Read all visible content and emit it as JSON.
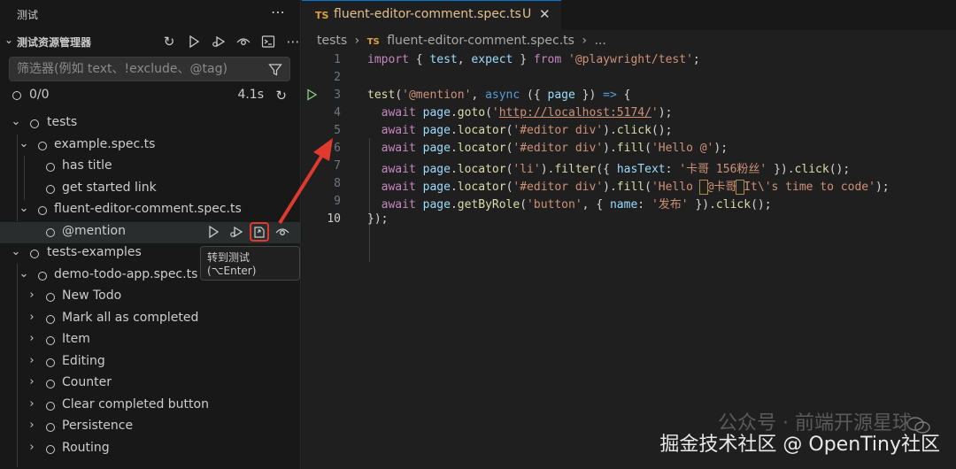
{
  "sidebar": {
    "title": "测试",
    "explorer_title": "测试资源管理器",
    "filter_placeholder": "筛选器(例如 text、!exclude、@tag)",
    "status_count": "0/0",
    "status_time": "4.1s",
    "toolbar_icons": [
      "refresh-icon",
      "run-all-icon",
      "debug-all-icon",
      "watch-icon",
      "terminal-icon",
      "more-icon"
    ]
  },
  "tree": {
    "tests": "tests",
    "example_spec": "example.spec.ts",
    "has_title": "has title",
    "get_started": "get started link",
    "fluent_spec": "fluent-editor-comment.spec.ts",
    "mention": "@mention",
    "tests_examples": "tests-examples",
    "demo_spec": "demo-todo-app.spec.ts",
    "items": [
      "New Todo",
      "Mark all as completed",
      "Item",
      "Editing",
      "Counter",
      "Clear completed button",
      "Persistence",
      "Routing"
    ]
  },
  "tooltip": "转到测试 (⌥Enter)",
  "editor": {
    "tab_badge": "TS",
    "tab_name": "fluent-editor-comment.spec.ts",
    "tab_status": "U",
    "breadcrumb": [
      "tests",
      "fluent-editor-comment.spec.ts",
      "..."
    ],
    "line_numbers": [
      "1",
      "2",
      "3",
      "4",
      "5",
      "6",
      "7",
      "8",
      "9",
      "10"
    ],
    "current_line": "10"
  },
  "watermark": {
    "top": "公众号 · 前端开源星球",
    "bottom": "掘金技术社区 @ OpenTiny社区"
  },
  "colors": {
    "accent": "#0078d4",
    "highlight_red": "#e03a2f",
    "ts_badge": "#e0a03f"
  }
}
